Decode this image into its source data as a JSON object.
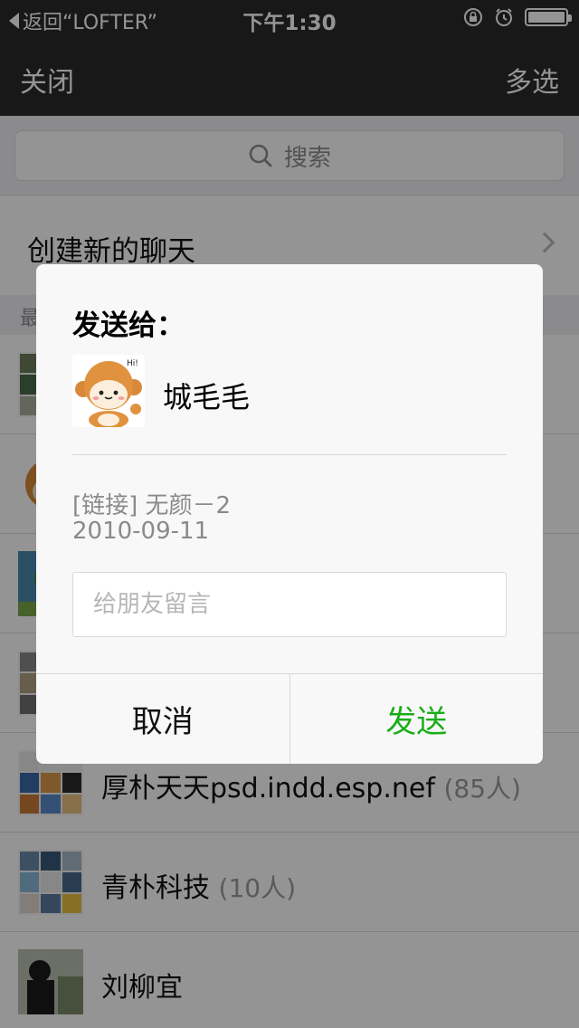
{
  "status_bar": {
    "back_label": "返回“LOFTER”",
    "time": "下午1:30",
    "battery_icon": "battery-full-icon"
  },
  "nav": {
    "close_label": "关闭",
    "multi_select_label": "多选"
  },
  "search": {
    "placeholder": "搜索"
  },
  "new_chat": {
    "label": "创建新的聊天"
  },
  "recent": {
    "header": "最"
  },
  "chats": [
    {
      "name": "厚朴天天psd.indd.esp.nef",
      "count": "(85人)"
    },
    {
      "name": "青朴科技",
      "count": "(10人)"
    },
    {
      "name": "刘柳宜",
      "count": ""
    }
  ],
  "dialog": {
    "title": "发送给：",
    "recipient_name": "城毛毛",
    "recipient_bubble": "Hi!",
    "link_title": "[链接] 无颜－2",
    "link_date": "2010-09-11",
    "message_placeholder": "给朋友留言",
    "message_value": "",
    "cancel_label": "取消",
    "send_label": "发送"
  },
  "colors": {
    "nav_bg": "#2a2a2c",
    "send_green": "#1aad19",
    "overlay": "rgba(0,0,0,0.42)"
  }
}
